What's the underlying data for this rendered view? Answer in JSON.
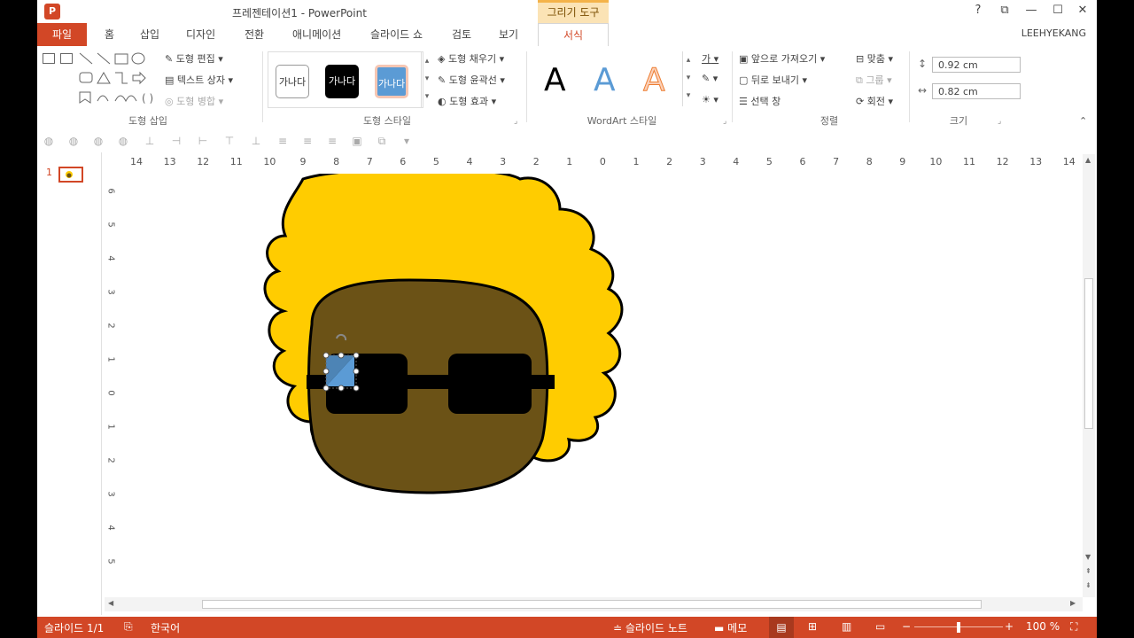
{
  "title": "프레젠테이션1 - PowerPoint",
  "context_tab": "그리기 도구",
  "window": {
    "help": "?",
    "restore_ribbon": "⧉",
    "minimize": "—",
    "maximize": "☐",
    "close": "✕"
  },
  "tabs": [
    "파일",
    "홈",
    "삽입",
    "디자인",
    "전환",
    "애니메이션",
    "슬라이드 쇼",
    "검토",
    "보기",
    "서식"
  ],
  "user": "LEEHYEKANG",
  "ribbon": {
    "insert_shapes": {
      "label": "도형 삽입",
      "edit_shape": "도형 편집",
      "text_box": "텍스트 상자",
      "merge_shapes": "도형 병합"
    },
    "shape_styles": {
      "label": "도형 스타일",
      "preview_text": "가나다",
      "fill": "도형 채우기",
      "outline": "도형 윤곽선",
      "effects": "도형 효과"
    },
    "wordart": {
      "label": "WordArt 스타일",
      "letter": "A",
      "text_fill_glyph": "가"
    },
    "arrange": {
      "label": "정렬",
      "bring_forward": "앞으로 가져오기",
      "send_backward": "뒤로 보내기",
      "selection_pane": "선택 창",
      "align": "맞춤",
      "group": "그룹",
      "rotate": "회전"
    },
    "size": {
      "label": "크기",
      "height": "0.92 cm",
      "width": "0.82 cm"
    }
  },
  "ruler_h": [
    "14",
    "13",
    "12",
    "11",
    "10",
    "9",
    "8",
    "7",
    "6",
    "5",
    "4",
    "3",
    "2",
    "1",
    "0",
    "1",
    "2",
    "3",
    "4",
    "5",
    "6",
    "7",
    "8",
    "9",
    "10",
    "11",
    "12",
    "13",
    "14"
  ],
  "ruler_v": [
    "6",
    "5",
    "4",
    "3",
    "2",
    "1",
    "0",
    "1",
    "2",
    "3",
    "4",
    "5"
  ],
  "slides": {
    "number": "1"
  },
  "colors": {
    "accent": "#d24726",
    "hair": "#ffcc00",
    "face": "#6b5216",
    "glasses": "#000000",
    "selected_shape": "#5b9bd5"
  },
  "status": {
    "slide": "슬라이드 1/1",
    "language": "한국어",
    "notes": "슬라이드 노트",
    "comments": "메모",
    "zoom": "100 %",
    "zoom_level": 0.5
  }
}
